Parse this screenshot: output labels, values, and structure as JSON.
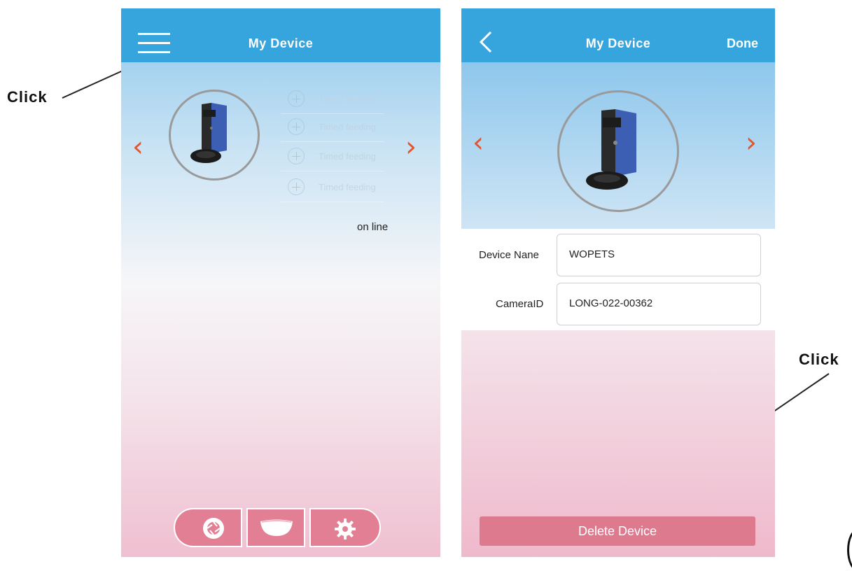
{
  "annotations": {
    "left_click": "Click",
    "right_click": "Click"
  },
  "left_screen": {
    "title": "My Device",
    "menu_icon": "hamburger-menu-icon",
    "schedule": [
      {
        "label": "Timed feeding"
      },
      {
        "label": "Timed feeding"
      },
      {
        "label": "Timed feeding"
      },
      {
        "label": "Timed feeding"
      }
    ],
    "status": "on line",
    "prev_arrow": "‹",
    "next_arrow": "›",
    "bottom_nav": [
      "camera-shutter-icon",
      "food-bowl-icon",
      "gear-icon"
    ]
  },
  "right_screen": {
    "title": "My Device",
    "done_label": "Done",
    "prev_arrow": "‹",
    "next_arrow": "›",
    "device_name_label": "Device Nane",
    "device_name_value": "WOPETS",
    "camera_id_label": "CameraID",
    "camera_id_value": "LONG-022-00362",
    "delete_label": "Delete Device"
  },
  "colors": {
    "header": "#36a4dd",
    "accent_arrow": "#e2542e",
    "delete_button": "#de7a8d",
    "bottom_nav": "#e27f95"
  }
}
